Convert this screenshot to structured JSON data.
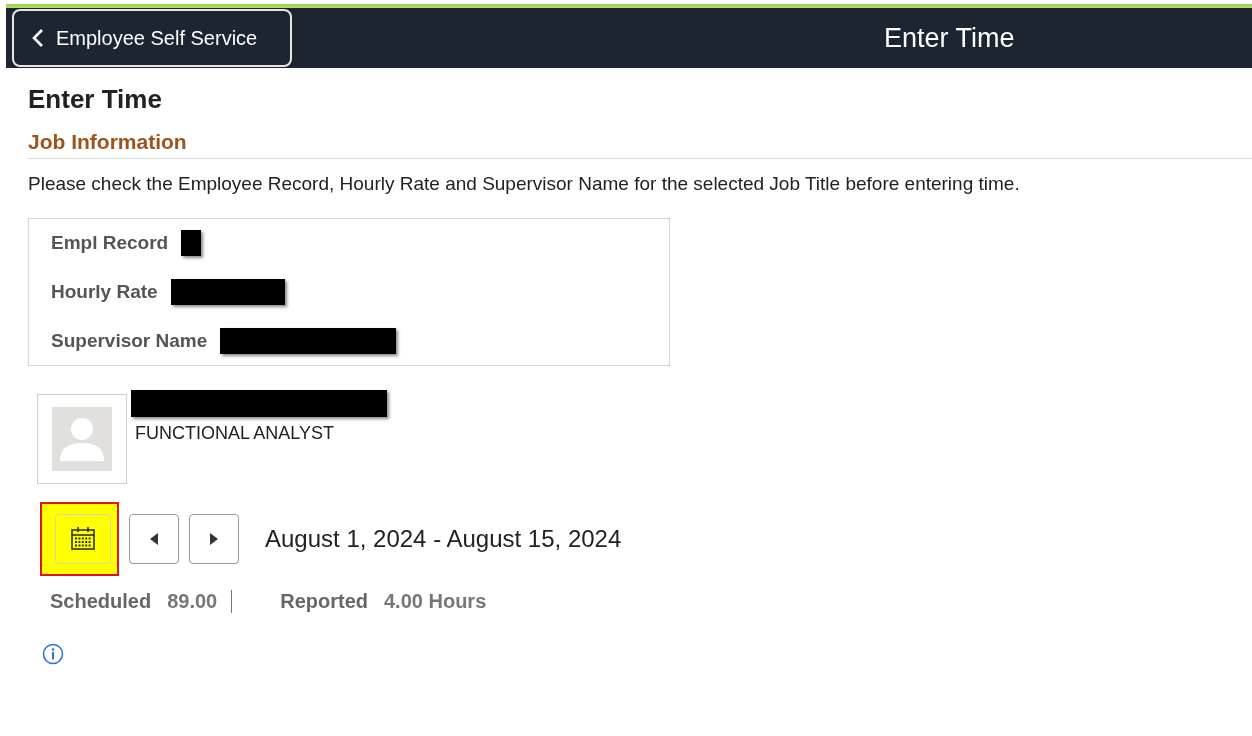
{
  "header": {
    "back_button": "Employee Self Service",
    "title": "Enter Time"
  },
  "page_title": "Enter Time",
  "section_title": "Job Information",
  "instructions": "Please check the Employee Record, Hourly Rate and Supervisor Name for the selected Job Title before entering time.",
  "job_fields": [
    {
      "label": "Empl Record",
      "redacted": true
    },
    {
      "label": "Hourly Rate",
      "redacted": true
    },
    {
      "label": "Supervisor Name",
      "redacted": true
    }
  ],
  "employee": {
    "name_redacted": true,
    "job_title": "FUNCTIONAL ANALYST"
  },
  "period": {
    "calendar_highlighted": true,
    "range": "August 1, 2024 - August 15, 2024"
  },
  "summary": [
    {
      "label": "Scheduled",
      "value": "89.00"
    },
    {
      "label": "Reported",
      "value": "4.00 Hours"
    }
  ]
}
